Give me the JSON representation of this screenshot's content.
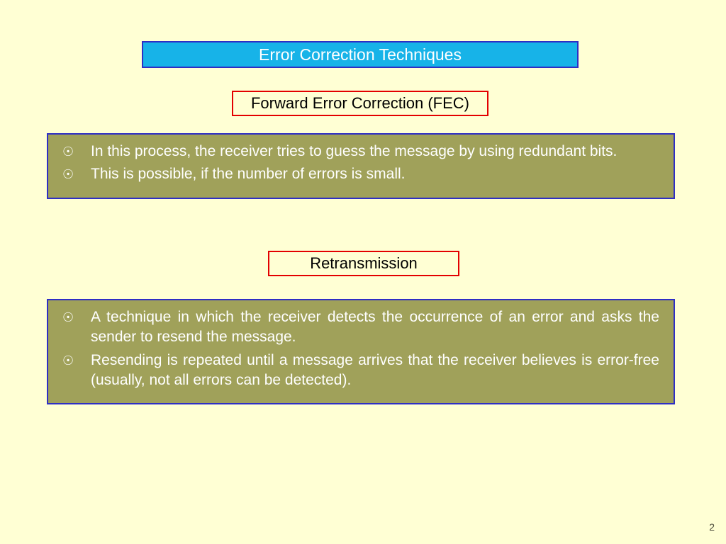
{
  "title": "Error Correction Techniques",
  "section1": {
    "heading": "Forward Error Correction (FEC)",
    "bullets": [
      "In this process, the receiver tries to guess the message by using redundant bits.",
      "This is possible, if the number of errors is small."
    ]
  },
  "section2": {
    "heading": "Retransmission",
    "bullets": [
      "A technique in which the receiver detects the occurrence of an error and asks the sender to resend the message.",
      "Resending is repeated until a message arrives that the receiver believes is error-free (usually, not all errors can be detected)."
    ]
  },
  "pageNumber": "2",
  "bulletChar": "☉"
}
